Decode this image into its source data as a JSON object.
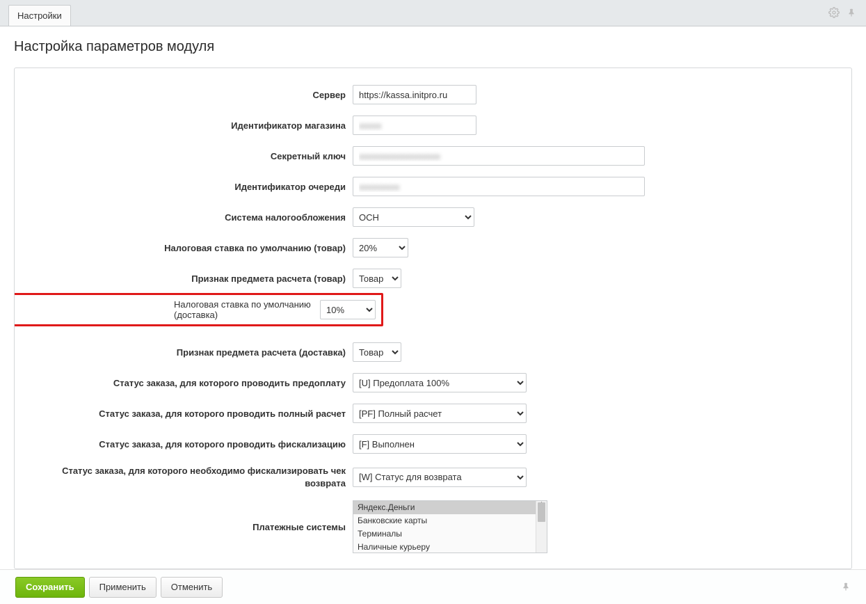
{
  "tab_label": "Настройки",
  "page_title": "Настройка параметров модуля",
  "labels": {
    "server": "Сервер",
    "shop_id": "Идентификатор магазина",
    "secret": "Секретный ключ",
    "queue": "Идентификатор очереди",
    "tax_system": "Система налогообложения",
    "tax_rate_product": "Налоговая ставка по умолчанию (товар)",
    "subject_product": "Признак предмета расчета (товар)",
    "tax_rate_delivery": "Налоговая ставка по умолчанию (доставка)",
    "subject_delivery": "Признак предмета расчета (доставка)",
    "status_prepay": "Статус заказа, для которого проводить предоплату",
    "status_fullpay": "Статус заказа, для которого проводить полный расчет",
    "status_fiscal": "Статус заказа, для которого проводить фискализацию",
    "status_refund": "Статус заказа, для которого необходимо фискализировать чек возврата",
    "paysystems": "Платежные системы"
  },
  "values": {
    "server": "https://kassa.initpro.ru",
    "shop_id": "",
    "secret": "",
    "queue": "",
    "tax_system": "ОСН",
    "tax_rate_product": "20%",
    "subject_product": "Товар",
    "tax_rate_delivery": "10%",
    "subject_delivery": "Товар",
    "status_prepay": "[U] Предоплата 100%",
    "status_fullpay": "[PF] Полный расчет",
    "status_fiscal": "[F] Выполнен",
    "status_refund": "[W] Статус для возврата"
  },
  "paysystems": [
    "Яндекс.Деньги",
    "Банковские карты",
    "Терминалы",
    "Наличные курьеру"
  ],
  "paysystems_selected_index": 0,
  "buttons": {
    "save": "Сохранить",
    "apply": "Применить",
    "cancel": "Отменить"
  }
}
